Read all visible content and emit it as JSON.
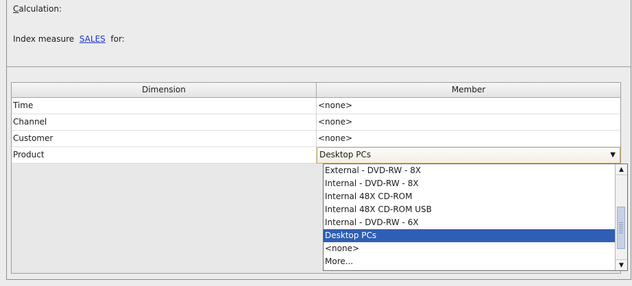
{
  "calculation": {
    "mnemonic": "C",
    "label_rest": "alculation:"
  },
  "index_line": {
    "prefix": "Index measure  ",
    "measure": "SALES",
    "suffix": "  for:"
  },
  "table": {
    "headers": {
      "dimension": "Dimension",
      "member": "Member"
    },
    "rows": [
      {
        "dimension": "Time",
        "member": "<none>"
      },
      {
        "dimension": "Channel",
        "member": "<none>"
      },
      {
        "dimension": "Customer",
        "member": "<none>"
      },
      {
        "dimension": "Product",
        "member": "Desktop PCs"
      }
    ]
  },
  "dropdown": {
    "arrow_icon": "triangle-down",
    "items": [
      "External - DVD-RW - 8X",
      "Internal - DVD-RW - 8X",
      "Internal 48X CD-ROM",
      "Internal 48X CD-ROM USB",
      "Internal - DVD-RW - 6X",
      "Desktop PCs",
      "<none>",
      "More..."
    ],
    "selected": "Desktop PCs"
  },
  "colors": {
    "link": "#1a34d6",
    "selection": "#2f5fb5",
    "combo_border": "#e3a43a"
  }
}
